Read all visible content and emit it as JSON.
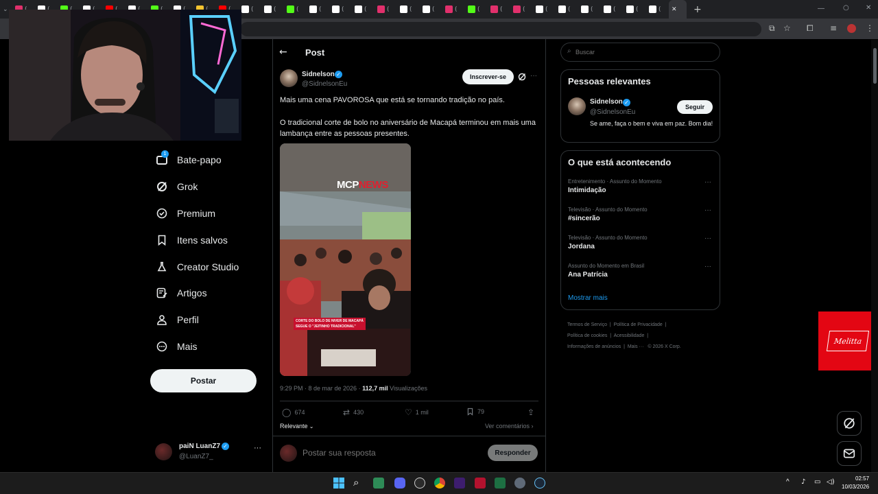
{
  "browser": {
    "tabs": [
      {
        "icon": "instagram-icon",
        "color": "#e1306c"
      },
      {
        "icon": "tiktok-icon",
        "color": "#ffffff"
      },
      {
        "icon": "kick-icon",
        "color": "#53fc18"
      },
      {
        "icon": "x-icon",
        "color": "#ffffff"
      },
      {
        "icon": "youtube-icon",
        "color": "#ff0000"
      },
      {
        "icon": "tiktok-icon",
        "color": "#ffffff"
      },
      {
        "icon": "kick-icon",
        "color": "#53fc18"
      },
      {
        "icon": "x-icon",
        "color": "#ffffff"
      },
      {
        "icon": "crown-icon",
        "color": "#f4c430"
      },
      {
        "icon": "youtube-icon",
        "color": "#ff0000"
      },
      {
        "icon": "x-icon",
        "color": "#ffffff"
      },
      {
        "icon": "x-icon",
        "color": "#ffffff"
      },
      {
        "icon": "kick-icon",
        "color": "#53fc18"
      },
      {
        "icon": "tiktok-icon",
        "color": "#ffffff"
      },
      {
        "icon": "tiktok-icon",
        "color": "#ffffff"
      },
      {
        "icon": "tiktok-icon",
        "color": "#ffffff"
      },
      {
        "icon": "instagram-icon",
        "color": "#e1306c"
      },
      {
        "icon": "tiktok-icon",
        "color": "#ffffff"
      },
      {
        "icon": "tiktok-icon",
        "color": "#ffffff"
      },
      {
        "icon": "instagram-icon",
        "color": "#e1306c"
      },
      {
        "icon": "kick-icon",
        "color": "#53fc18"
      },
      {
        "icon": "instagram-icon",
        "color": "#e1306c"
      },
      {
        "icon": "instagram-icon",
        "color": "#e1306c"
      },
      {
        "icon": "x-icon",
        "color": "#ffffff"
      },
      {
        "icon": "tiktok-icon",
        "color": "#ffffff"
      },
      {
        "icon": "x-icon",
        "color": "#ffffff"
      },
      {
        "icon": "tiktok-icon",
        "color": "#ffffff"
      },
      {
        "icon": "tiktok-icon",
        "color": "#ffffff"
      },
      {
        "icon": "x-icon",
        "color": "#ffffff"
      }
    ]
  },
  "sidebar": {
    "items": [
      {
        "label": "Bate-papo",
        "icon": "chat-icon",
        "badge": "1"
      },
      {
        "label": "Grok",
        "icon": "grok-icon"
      },
      {
        "label": "Premium",
        "icon": "premium-icon"
      },
      {
        "label": "Itens salvos",
        "icon": "bookmark-icon"
      },
      {
        "label": "Creator Studio",
        "icon": "creator-studio-icon"
      },
      {
        "label": "Artigos",
        "icon": "articles-icon"
      },
      {
        "label": "Perfil",
        "icon": "profile-icon"
      },
      {
        "label": "Mais",
        "icon": "more-icon"
      }
    ],
    "post_button": "Postar",
    "account": {
      "name": "paiN LuanZ7",
      "handle": "@LuanZ7_"
    }
  },
  "post": {
    "header_title": "Post",
    "author": "Sidnelson",
    "handle": "@SidnelsonEu",
    "subscribe_label": "Inscrever-se",
    "text_line1": "Mais uma cena PAVOROSA que está se tornando tradição no país.",
    "text_line2": "O tradicional corte de bolo no aniversário de Macapá terminou em mais uma lambança entre as pessoas presentes.",
    "media": {
      "logo_part1": "MCP",
      "logo_part2": "NEWS",
      "caption_line1": "CORTE DO BOLO DE NIVER DE MACAPÁ",
      "caption_line2": "SEGUE O \"JEITINHO TRADICIONAL\""
    },
    "timestamp": "9:29 PM · 8 de mar de 2026 · ",
    "views_count": "112,7 mil",
    "views_label": " Visualizações",
    "replies": "674",
    "reposts": "430",
    "likes": "1 mil",
    "bookmarks": "79",
    "sort_label": "Relevante",
    "view_comments": "Ver comentários",
    "reply_placeholder": "Postar sua resposta",
    "reply_button": "Responder"
  },
  "right": {
    "search_placeholder": "Buscar",
    "relevant_title": "Pessoas relevantes",
    "person": {
      "name": "Sidnelson",
      "handle": "@SidnelsonEu",
      "follow": "Seguir",
      "bio": "Se ame, faça o bem e viva em paz. Bom dia!"
    },
    "trends_title": "O que está acontecendo",
    "trends": [
      {
        "category": "Entretenimento · Assunto do Momento",
        "name": "Intimidação"
      },
      {
        "category": "Televisão · Assunto do Momento",
        "name": "#sincerão"
      },
      {
        "category": "Televisão · Assunto do Momento",
        "name": "Jordana"
      },
      {
        "category": "Assunto do Momento em Brasil",
        "name": "Ana Patrícia"
      }
    ],
    "show_more": "Mostrar mais",
    "footer": {
      "terms": "Termos de Serviço",
      "privacy": "Política de Privacidade",
      "cookies": "Política de cookies",
      "accessibility": "Acessibilidade",
      "ads": "Informações de anúncios",
      "more": "Mais ···",
      "copyright": "© 2026 X Corp."
    }
  },
  "overlay": {
    "brand": "Melitta",
    "brand_color": "#e30613"
  },
  "taskbar": {
    "time": "02:57",
    "date": "10/03/2026"
  }
}
